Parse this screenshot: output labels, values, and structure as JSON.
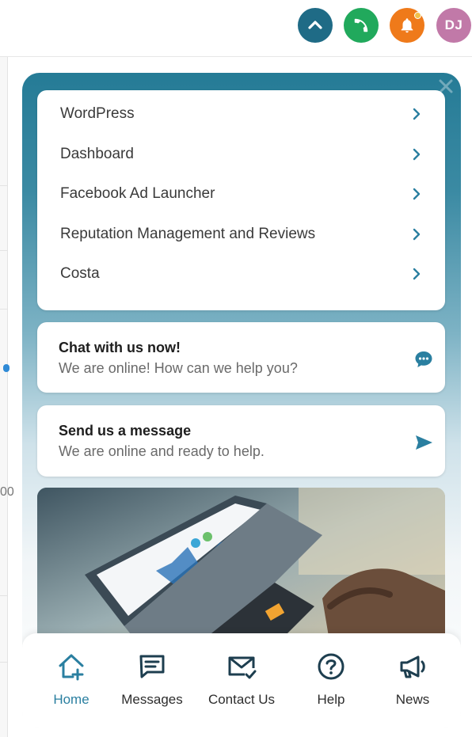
{
  "header": {
    "avatar_initials": "DJ",
    "icons": [
      "chevron-up-icon",
      "phone-icon",
      "bell-icon"
    ],
    "colors": {
      "up": "#1f6b86",
      "call": "#21a95c",
      "bell": "#ef7a1a",
      "avatar": "#c179a8"
    }
  },
  "background": {
    "partial_number": "00"
  },
  "menu": {
    "items": [
      {
        "label": "WordPress"
      },
      {
        "label": "Dashboard"
      },
      {
        "label": "Facebook Ad Launcher"
      },
      {
        "label": "Reputation Management and Reviews"
      },
      {
        "label": "Costa"
      }
    ]
  },
  "chat": {
    "title": "Chat with us now!",
    "subtitle": "We are online! How can we help you?"
  },
  "message": {
    "title": "Send us a message",
    "subtitle": "We are online and ready to help."
  },
  "nav": {
    "items": [
      {
        "label": "Home",
        "icon": "home-plus-icon",
        "active": true
      },
      {
        "label": "Messages",
        "icon": "message-icon",
        "active": false
      },
      {
        "label": "Contact Us",
        "icon": "mail-check-icon",
        "active": false
      },
      {
        "label": "Help",
        "icon": "question-icon",
        "active": false
      },
      {
        "label": "News",
        "icon": "megaphone-icon",
        "active": false
      }
    ]
  },
  "colors": {
    "accent": "#2a7fa0",
    "widget_top": "#257b96",
    "icon_dark": "#1d3e4f"
  }
}
